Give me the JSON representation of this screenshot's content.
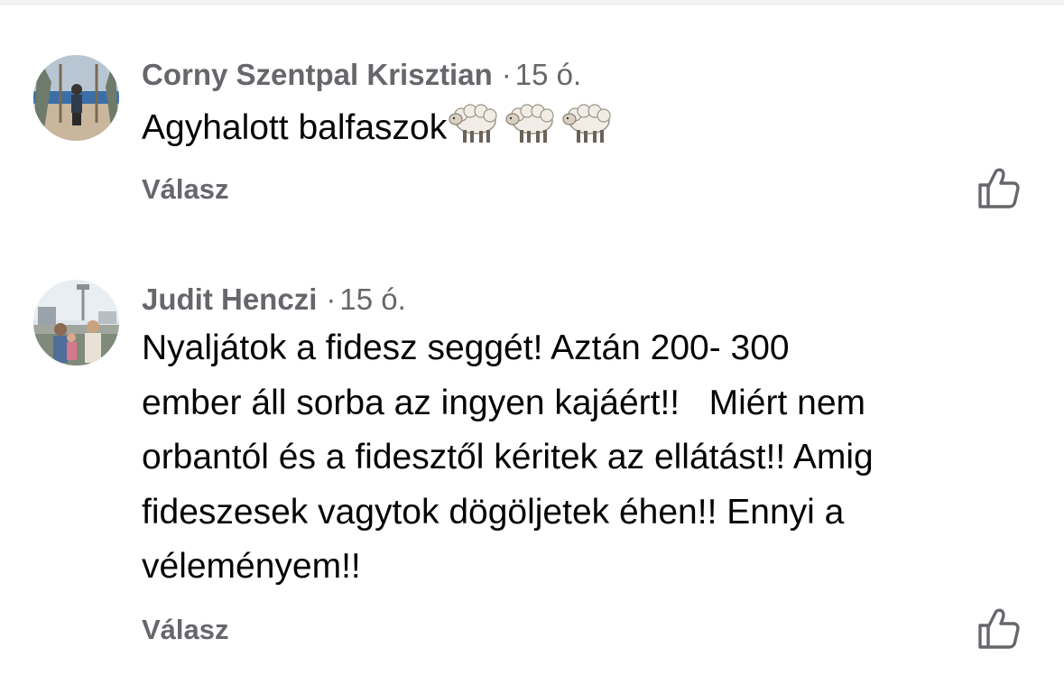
{
  "comments": [
    {
      "author": "Corny Szentpal Krisztian",
      "separator": "·",
      "time": "15 ó.",
      "text": "Agyhalott balfaszok",
      "emoji": "sheep-emoji ×3",
      "reply_label": "Válasz"
    },
    {
      "author": "Judit Henczi",
      "separator": "·",
      "time": "15 ó.",
      "text": "Nyaljátok a fidesz seggét! Aztán 200- 300\nember áll sorba az ingyen kajáért!!   Miért nem\norbantól és a fidesztől kéritek az ellátást!! Amig\nfideszesek vagytok dögöljetek éhen!! Ennyi a\nvéleményem!!",
      "reply_label": "Válasz"
    }
  ],
  "colors": {
    "meta_text": "#65676b",
    "body_text": "#050505",
    "icon": "#65676b"
  },
  "icons": {
    "like": "thumbs-up-outline-icon",
    "emoji": "sheep-emoji"
  }
}
